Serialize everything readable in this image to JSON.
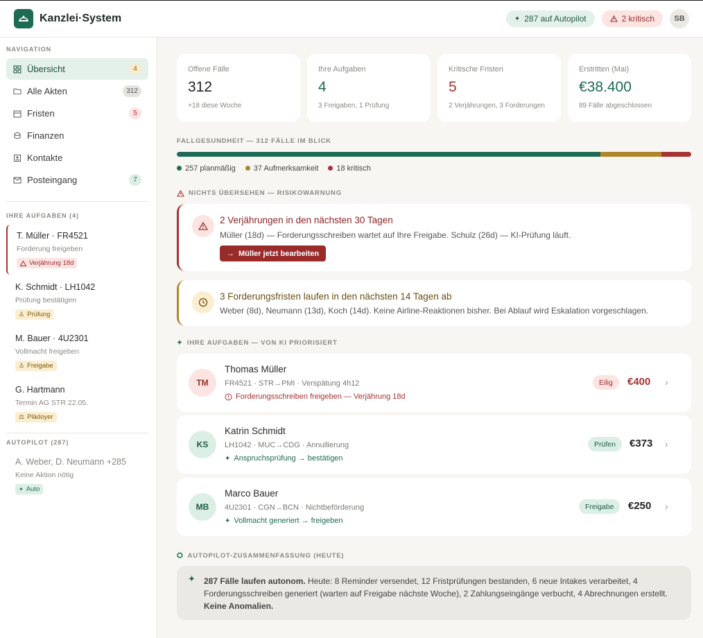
{
  "app": {
    "title": "Kanzlei·System"
  },
  "header": {
    "autopilot_badge": "287 auf Autopilot",
    "critical_badge": "2 kritisch",
    "user_initials": "SB"
  },
  "sidebar": {
    "nav_heading": "NAVIGATION",
    "nav_items": [
      {
        "label": "Übersicht",
        "count": "4",
        "icon": "dashboard-icon"
      },
      {
        "label": "Alle Akten",
        "count": "312",
        "icon": "folder-icon"
      },
      {
        "label": "Fristen",
        "count": "5",
        "icon": "calendar-icon"
      },
      {
        "label": "Finanzen",
        "count": "",
        "icon": "coins-icon"
      },
      {
        "label": "Kontakte",
        "count": "",
        "icon": "contact-icon"
      },
      {
        "label": "Posteingang",
        "count": "7",
        "icon": "mail-icon"
      }
    ],
    "tasks_heading": "IHRE AUFGABEN (4)",
    "tasks": [
      {
        "title": "T. Müller · FR4521",
        "sub": "Forderung freigeben",
        "chip": "Verjährung 18d"
      },
      {
        "title": "K. Schmidt · LH1042",
        "sub": "Prüfung bestätigen",
        "chip": "Prüfung"
      },
      {
        "title": "M. Bauer · 4U2301",
        "sub": "Vollmacht freigeben",
        "chip": "Freigabe"
      },
      {
        "title": "G. Hartmann",
        "sub": "Termin AG STR 22.05.",
        "chip": "Plädoyer"
      }
    ],
    "autopilot_heading": "AUTOPILOT (287)",
    "autopilot": {
      "title": "A. Weber, D. Neumann +285",
      "sub": "Keine Aktion nötig",
      "chip": "Auto"
    }
  },
  "kpis": [
    {
      "label": "Offene Fälle",
      "value": "312",
      "sub": "+18 diese Woche"
    },
    {
      "label": "Ihre Aufgaben",
      "value": "4",
      "sub": "3 Freigaben, 1 Prüfung"
    },
    {
      "label": "Kritische Fristen",
      "value": "5",
      "sub": "2 Verjährungen, 3 Forderungen"
    },
    {
      "label": "Erstritten (Mai)",
      "value": "€38.400",
      "sub": "89 Fälle abgeschlossen"
    }
  ],
  "health": {
    "heading": "FALLGESUNDHEIT — 312 FÄLLE IM BLICK",
    "segments": [
      {
        "label": "257 planmäßig",
        "value": 257,
        "color": "#1e6b55"
      },
      {
        "label": "37 Aufmerksamkeit",
        "value": 37,
        "color": "#b0862a"
      },
      {
        "label": "18 kritisch",
        "value": 18,
        "color": "#a83232"
      }
    ]
  },
  "risk": {
    "heading": "NICHTS ÜBERSEHEN — RISIKOWARNUNG",
    "alerts": [
      {
        "title": "2 Verjährungen in den nächsten 30 Tagen",
        "desc": "Müller (18d) — Forderungsschreiben wartet auf Ihre Freigabe. Schulz (26d) — KI-Prüfung läuft.",
        "action": "Müller jetzt bearbeiten"
      },
      {
        "title": "3 Forderungsfristen laufen in den nächsten 14 Tagen ab",
        "desc": "Weber (8d), Neumann (13d), Koch (14d). Keine Airline-Reaktionen bisher. Bei Ablauf wird Eskalation vorgeschlagen."
      }
    ]
  },
  "tasks_main": {
    "heading": "IHRE AUFGABEN — VON KI PRIORISIERT",
    "items": [
      {
        "initials": "TM",
        "name": "Thomas Müller",
        "meta": "FR4521 · STR→PMI · Verspätung 4h12",
        "status": "Forderungsschreiben freigeben — Verjährung 18d",
        "tag": "Eilig",
        "amount": "€400"
      },
      {
        "initials": "KS",
        "name": "Katrin Schmidt",
        "meta": "LH1042 · MUC→CDG · Annullierung",
        "status": "Anspruchsprüfung → bestätigen",
        "tag": "Prüfen",
        "amount": "€373"
      },
      {
        "initials": "MB",
        "name": "Marco Bauer",
        "meta": "4U2301 · CGN→BCN · Nichtbeförderung",
        "status": "Vollmacht generiert → freigeben",
        "tag": "Freigabe",
        "amount": "€250"
      }
    ]
  },
  "summary": {
    "heading": "AUTOPILOT-ZUSAMMENFASSUNG (HEUTE)",
    "lead": "287 Fälle laufen autonom.",
    "body": " Heute: 8 Reminder versendet, 12 Fristprüfungen bestanden, 6 neue Intakes verarbeitet, 4 Forderungsschreiben generiert (warten auf Freigabe nächste Woche), 2 Zahlungseingänge verbucht, 4 Abrechnungen erstellt. ",
    "tail": "Keine Anomalien."
  },
  "colors": {
    "accent": "#1e6b55",
    "critical": "#a83232",
    "warning": "#b0862a"
  }
}
